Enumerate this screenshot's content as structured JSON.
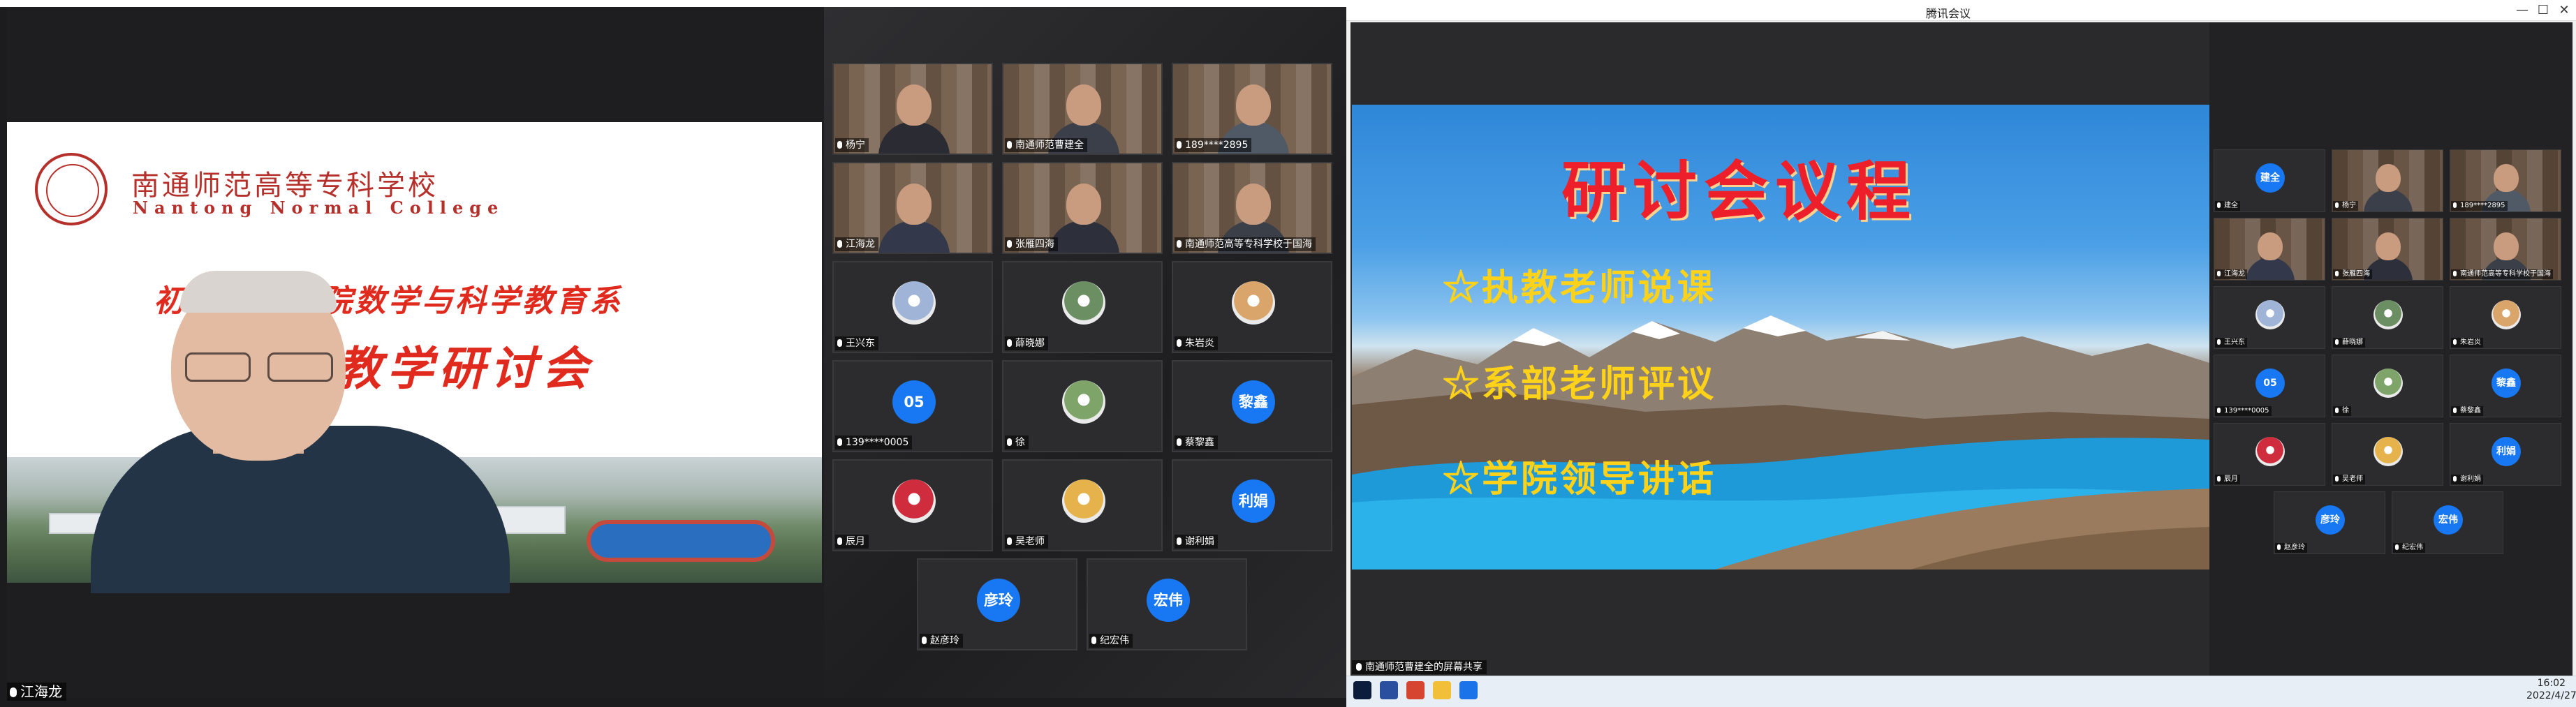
{
  "left_meeting": {
    "slide": {
      "school_name_cn": "南通师范高等专科学校",
      "school_name_en": "Nantong Normal College",
      "subtitle": "初等教育学院数学与科学教育系",
      "title": "教学研讨会"
    },
    "speaker_name": "江海龙",
    "participants": [
      {
        "name": "杨宁",
        "type": "video"
      },
      {
        "name": "南通师范曹建全",
        "type": "video",
        "host": true
      },
      {
        "name": "189****2895",
        "type": "video"
      },
      {
        "name": "江海龙",
        "type": "video"
      },
      {
        "name": "张雁四海",
        "type": "video"
      },
      {
        "name": "南通师范高等专科学校于国海",
        "type": "video"
      },
      {
        "name": "王兴东",
        "type": "photo",
        "color": "#9fb4d6"
      },
      {
        "name": "薛晓娜",
        "type": "photo",
        "color": "#6b8f62"
      },
      {
        "name": "朱岩炎",
        "type": "photo",
        "color": "#d9a56a"
      },
      {
        "name": "139****0005",
        "type": "avatar",
        "avatar_text": "05"
      },
      {
        "name": "徐",
        "type": "photo",
        "color": "#7fa46a"
      },
      {
        "name": "蔡黎鑫",
        "type": "avatar",
        "avatar_text": "黎鑫"
      },
      {
        "name": "辰月",
        "type": "photo",
        "color": "#cf2d3d"
      },
      {
        "name": "吴老师",
        "type": "photo",
        "color": "#e6b24b"
      },
      {
        "name": "谢利娟",
        "type": "avatar",
        "avatar_text": "利娟"
      },
      {
        "name": "赵彦玲",
        "type": "avatar",
        "avatar_text": "彦玲"
      },
      {
        "name": "纪宏伟",
        "type": "avatar",
        "avatar_text": "宏伟"
      }
    ]
  },
  "right_meeting": {
    "window_title": "腾讯会议",
    "window_controls": {
      "minimize": "—",
      "maximize": "☐",
      "close": "✕"
    },
    "ppt": {
      "title": "研讨会议程",
      "items": [
        "☆执教老师说课",
        "☆系部老师评议",
        "☆学院领导讲话"
      ]
    },
    "share_status": "南通师范曹建全的屏幕共享",
    "participants": [
      {
        "name": "建全",
        "type": "avatar",
        "avatar_text": "建全"
      },
      {
        "name": "杨宁",
        "type": "video"
      },
      {
        "name": "189****2895",
        "type": "video"
      },
      {
        "name": "江海龙",
        "type": "video"
      },
      {
        "name": "张雁四海",
        "type": "video"
      },
      {
        "name": "南通师范高等专科学校于国海",
        "type": "video"
      },
      {
        "name": "王兴东",
        "type": "photo",
        "color": "#9fb4d6"
      },
      {
        "name": "薛晓娜",
        "type": "photo",
        "color": "#6b8f62"
      },
      {
        "name": "朱岩炎",
        "type": "photo",
        "color": "#d9a56a"
      },
      {
        "name": "139****0005",
        "type": "avatar",
        "avatar_text": "05"
      },
      {
        "name": "徐",
        "type": "photo",
        "color": "#7fa46a"
      },
      {
        "name": "蔡黎鑫",
        "type": "avatar",
        "avatar_text": "黎鑫"
      },
      {
        "name": "辰月",
        "type": "photo",
        "color": "#cf2d3d"
      },
      {
        "name": "吴老师",
        "type": "photo",
        "color": "#e6b24b"
      },
      {
        "name": "谢利娟",
        "type": "avatar",
        "avatar_text": "利娟"
      },
      {
        "name": "赵彦玲",
        "type": "avatar",
        "avatar_text": "彦玲"
      },
      {
        "name": "纪宏伟",
        "type": "avatar",
        "avatar_text": "宏伟"
      }
    ],
    "taskbar": {
      "time": "16:02",
      "date": "2022/4/27",
      "apps": [
        "start-icon",
        "browser-icon",
        "app-icon",
        "folder-icon",
        "meeting-icon"
      ]
    }
  },
  "colors": {
    "accent_blue": "#1877f2",
    "slide_red": "#e12a1e",
    "ppt_title_red": "#ec1f2a",
    "ppt_item_yellow": "#ffd21a"
  }
}
